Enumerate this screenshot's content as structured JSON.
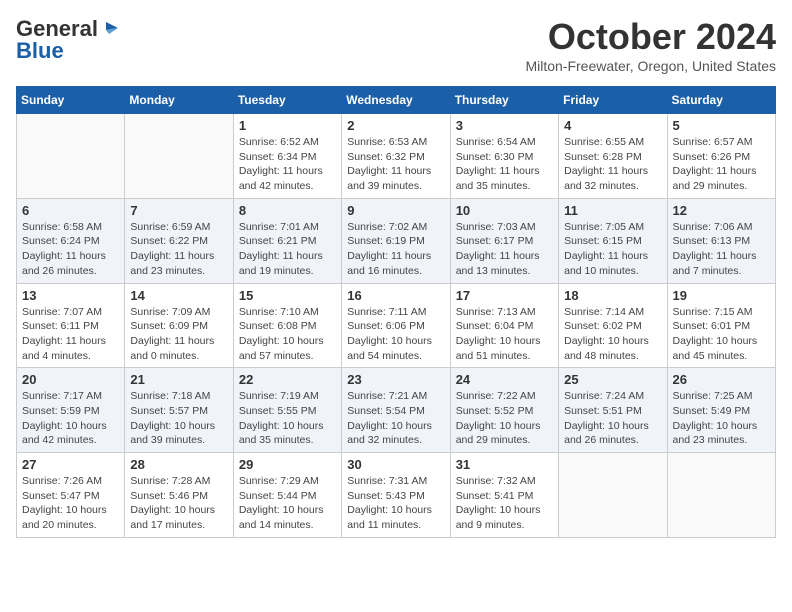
{
  "logo": {
    "line1": "General",
    "line2": "Blue"
  },
  "title": "October 2024",
  "location": "Milton-Freewater, Oregon, United States",
  "weekdays": [
    "Sunday",
    "Monday",
    "Tuesday",
    "Wednesday",
    "Thursday",
    "Friday",
    "Saturday"
  ],
  "weeks": [
    [
      {
        "day": "",
        "info": ""
      },
      {
        "day": "",
        "info": ""
      },
      {
        "day": "1",
        "info": "Sunrise: 6:52 AM\nSunset: 6:34 PM\nDaylight: 11 hours and 42 minutes."
      },
      {
        "day": "2",
        "info": "Sunrise: 6:53 AM\nSunset: 6:32 PM\nDaylight: 11 hours and 39 minutes."
      },
      {
        "day": "3",
        "info": "Sunrise: 6:54 AM\nSunset: 6:30 PM\nDaylight: 11 hours and 35 minutes."
      },
      {
        "day": "4",
        "info": "Sunrise: 6:55 AM\nSunset: 6:28 PM\nDaylight: 11 hours and 32 minutes."
      },
      {
        "day": "5",
        "info": "Sunrise: 6:57 AM\nSunset: 6:26 PM\nDaylight: 11 hours and 29 minutes."
      }
    ],
    [
      {
        "day": "6",
        "info": "Sunrise: 6:58 AM\nSunset: 6:24 PM\nDaylight: 11 hours and 26 minutes."
      },
      {
        "day": "7",
        "info": "Sunrise: 6:59 AM\nSunset: 6:22 PM\nDaylight: 11 hours and 23 minutes."
      },
      {
        "day": "8",
        "info": "Sunrise: 7:01 AM\nSunset: 6:21 PM\nDaylight: 11 hours and 19 minutes."
      },
      {
        "day": "9",
        "info": "Sunrise: 7:02 AM\nSunset: 6:19 PM\nDaylight: 11 hours and 16 minutes."
      },
      {
        "day": "10",
        "info": "Sunrise: 7:03 AM\nSunset: 6:17 PM\nDaylight: 11 hours and 13 minutes."
      },
      {
        "day": "11",
        "info": "Sunrise: 7:05 AM\nSunset: 6:15 PM\nDaylight: 11 hours and 10 minutes."
      },
      {
        "day": "12",
        "info": "Sunrise: 7:06 AM\nSunset: 6:13 PM\nDaylight: 11 hours and 7 minutes."
      }
    ],
    [
      {
        "day": "13",
        "info": "Sunrise: 7:07 AM\nSunset: 6:11 PM\nDaylight: 11 hours and 4 minutes."
      },
      {
        "day": "14",
        "info": "Sunrise: 7:09 AM\nSunset: 6:09 PM\nDaylight: 11 hours and 0 minutes."
      },
      {
        "day": "15",
        "info": "Sunrise: 7:10 AM\nSunset: 6:08 PM\nDaylight: 10 hours and 57 minutes."
      },
      {
        "day": "16",
        "info": "Sunrise: 7:11 AM\nSunset: 6:06 PM\nDaylight: 10 hours and 54 minutes."
      },
      {
        "day": "17",
        "info": "Sunrise: 7:13 AM\nSunset: 6:04 PM\nDaylight: 10 hours and 51 minutes."
      },
      {
        "day": "18",
        "info": "Sunrise: 7:14 AM\nSunset: 6:02 PM\nDaylight: 10 hours and 48 minutes."
      },
      {
        "day": "19",
        "info": "Sunrise: 7:15 AM\nSunset: 6:01 PM\nDaylight: 10 hours and 45 minutes."
      }
    ],
    [
      {
        "day": "20",
        "info": "Sunrise: 7:17 AM\nSunset: 5:59 PM\nDaylight: 10 hours and 42 minutes."
      },
      {
        "day": "21",
        "info": "Sunrise: 7:18 AM\nSunset: 5:57 PM\nDaylight: 10 hours and 39 minutes."
      },
      {
        "day": "22",
        "info": "Sunrise: 7:19 AM\nSunset: 5:55 PM\nDaylight: 10 hours and 35 minutes."
      },
      {
        "day": "23",
        "info": "Sunrise: 7:21 AM\nSunset: 5:54 PM\nDaylight: 10 hours and 32 minutes."
      },
      {
        "day": "24",
        "info": "Sunrise: 7:22 AM\nSunset: 5:52 PM\nDaylight: 10 hours and 29 minutes."
      },
      {
        "day": "25",
        "info": "Sunrise: 7:24 AM\nSunset: 5:51 PM\nDaylight: 10 hours and 26 minutes."
      },
      {
        "day": "26",
        "info": "Sunrise: 7:25 AM\nSunset: 5:49 PM\nDaylight: 10 hours and 23 minutes."
      }
    ],
    [
      {
        "day": "27",
        "info": "Sunrise: 7:26 AM\nSunset: 5:47 PM\nDaylight: 10 hours and 20 minutes."
      },
      {
        "day": "28",
        "info": "Sunrise: 7:28 AM\nSunset: 5:46 PM\nDaylight: 10 hours and 17 minutes."
      },
      {
        "day": "29",
        "info": "Sunrise: 7:29 AM\nSunset: 5:44 PM\nDaylight: 10 hours and 14 minutes."
      },
      {
        "day": "30",
        "info": "Sunrise: 7:31 AM\nSunset: 5:43 PM\nDaylight: 10 hours and 11 minutes."
      },
      {
        "day": "31",
        "info": "Sunrise: 7:32 AM\nSunset: 5:41 PM\nDaylight: 10 hours and 9 minutes."
      },
      {
        "day": "",
        "info": ""
      },
      {
        "day": "",
        "info": ""
      }
    ]
  ]
}
